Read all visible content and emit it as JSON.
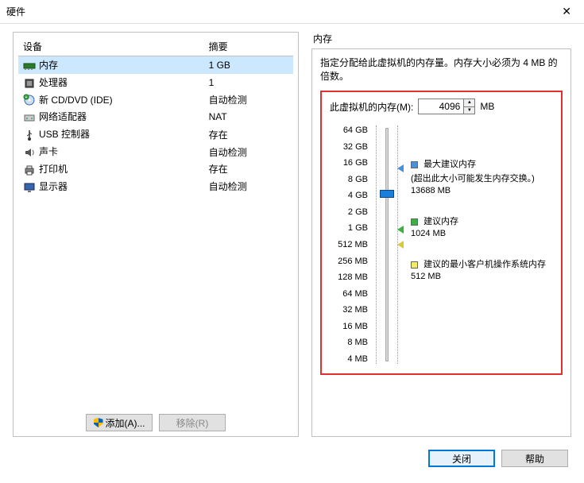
{
  "window": {
    "title": "硬件"
  },
  "devices": {
    "headers": {
      "device": "设备",
      "summary": "摘要"
    },
    "rows": [
      {
        "name": "内存",
        "summary": "1 GB",
        "icon": "memory",
        "selected": true
      },
      {
        "name": "处理器",
        "summary": "1",
        "icon": "cpu"
      },
      {
        "name": "新 CD/DVD (IDE)",
        "summary": "自动检测",
        "icon": "cd"
      },
      {
        "name": "网络适配器",
        "summary": "NAT",
        "icon": "net"
      },
      {
        "name": "USB 控制器",
        "summary": "存在",
        "icon": "usb"
      },
      {
        "name": "声卡",
        "summary": "自动检测",
        "icon": "sound"
      },
      {
        "name": "打印机",
        "summary": "存在",
        "icon": "printer"
      },
      {
        "name": "显示器",
        "summary": "自动检测",
        "icon": "display"
      }
    ]
  },
  "buttons": {
    "add": "添加(A)...",
    "remove": "移除(R)",
    "close": "关闭",
    "help": "帮助"
  },
  "memory": {
    "group_title": "内存",
    "desc": "指定分配给此虚拟机的内存量。内存大小必须为 4 MB 的倍数。",
    "label": "此虚拟机的内存(M):",
    "value": "4096",
    "unit": "MB",
    "ticks": [
      "64 GB",
      "32 GB",
      "16 GB",
      "8 GB",
      "4 GB",
      "2 GB",
      "1 GB",
      "512 MB",
      "256 MB",
      "128 MB",
      "64 MB",
      "32 MB",
      "16 MB",
      "8 MB",
      "4 MB"
    ],
    "legend": {
      "max": {
        "title": "最大建议内存",
        "note": "(超出此大小可能发生内存交换。)",
        "value": "13688 MB"
      },
      "rec": {
        "title": "建议内存",
        "value": "1024 MB"
      },
      "min": {
        "title": "建议的最小客户机操作系统内存",
        "value": "512 MB"
      }
    }
  }
}
